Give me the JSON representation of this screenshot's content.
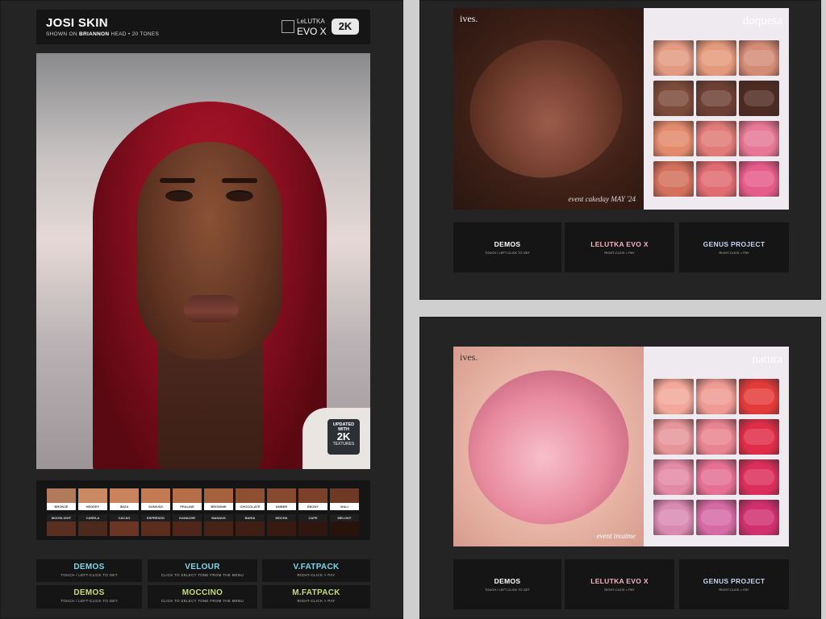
{
  "josi": {
    "title": "JOSI SKIN",
    "subtitle_pre": "SHOWN ON",
    "subtitle_head": "BRIANNON",
    "subtitle_post": "HEAD  •  20 TONES",
    "brand_line1": "LeLUTKA",
    "brand_line2": "EVO X",
    "badge_2k": "2K",
    "updated_badge": {
      "line1": "UPDATED WITH",
      "line2": "2K",
      "line3": "TEXTURES"
    }
  },
  "swatches_row1": [
    {
      "name": "BRONZE",
      "color": "#b17a5a"
    },
    {
      "name": "HEDDEY",
      "color": "#c98a63"
    },
    {
      "name": "IBIZA",
      "color": "#c9845d"
    },
    {
      "name": "SUNKISS",
      "color": "#c47a53"
    },
    {
      "name": "PRALINE",
      "color": "#b66e49"
    },
    {
      "name": "BROWNIE",
      "color": "#a5603e"
    },
    {
      "name": "CHOCOLATE",
      "color": "#8f4f33"
    },
    {
      "name": "AMBER",
      "color": "#87492f"
    },
    {
      "name": "EBONY",
      "color": "#7c4229"
    },
    {
      "name": "MALI",
      "color": "#6e3a25"
    }
  ],
  "swatches_row2": [
    {
      "name": "MOONLIGHT",
      "color": "#5a2f20"
    },
    {
      "name": "CARELA",
      "color": "#4d281c"
    },
    {
      "name": "CACAO",
      "color": "#6b3524"
    },
    {
      "name": "ESPRESSO",
      "color": "#5c2d1f"
    },
    {
      "name": "GANACHE",
      "color": "#4f2619"
    },
    {
      "name": "MANAUS",
      "color": "#472216"
    },
    {
      "name": "BAHIA",
      "color": "#3f1e14"
    },
    {
      "name": "MOCHA",
      "color": "#371a11"
    },
    {
      "name": "CAFE",
      "color": "#2f160e"
    },
    {
      "name": "MELONY",
      "color": "#28130c"
    }
  ],
  "left_buttons": [
    {
      "label": "DEMOS",
      "sub": "TOUCH / LEFT-CLICK TO GET",
      "color": "#7fd6e6"
    },
    {
      "label": "VELOUR",
      "sub": "CLICK TO SELECT TONE FROM THE MENU",
      "color": "#7fd6e6"
    },
    {
      "label": "V.FATPACK",
      "sub": "RIGHT-CLICK > PAY",
      "color": "#7fd6e6"
    },
    {
      "label": "DEMOS",
      "sub": "TOUCH / LEFT-CLICK TO GET",
      "color": "#c6dc7a"
    },
    {
      "label": "MOCCINO",
      "sub": "CLICK TO SELECT TONE FROM THE MENU",
      "color": "#c6dc7a"
    },
    {
      "label": "M.FATPACK",
      "sub": "RIGHT-CLICK > PAY",
      "color": "#c6dc7a"
    }
  ],
  "duquesa": {
    "brand": "ives.",
    "collection": "duquesa",
    "event": "event cakeday MAY '24",
    "cells": [
      "#e29a82",
      "#e49a7c",
      "#d58c77",
      "#7c4a3a",
      "#6d3f33",
      "#4d2a22",
      "#e28a6c",
      "#e07b78",
      "#e67896",
      "#d2705b",
      "#e06c72",
      "#e55c8a"
    ],
    "buttons": [
      {
        "label": "DEMOS",
        "sub": "TOUCH / LEFT-CLICK TO GET",
        "color": "#ffffff"
      },
      {
        "label": "LELUTKA EVO X",
        "sub": "RIGHT-CLICK > PAY",
        "color": "#f2b6c4"
      },
      {
        "label": "GENUS PROJECT",
        "sub": "RIGHT-CLICK > PAY",
        "color": "#c6d4f2"
      }
    ]
  },
  "natura": {
    "brand": "ives.",
    "collection": "natura",
    "event": "event treatme",
    "cells": [
      "#f2a89a",
      "#ef9b94",
      "#e33b3a",
      "#e6969a",
      "#e88491",
      "#e02c48",
      "#e28aa6",
      "#e57095",
      "#dc2e5a",
      "#d98ab2",
      "#d56aa4",
      "#d0306e"
    ],
    "buttons": [
      {
        "label": "DEMOS",
        "sub": "TOUCH / LEFT-CLICK TO GET",
        "color": "#ffffff"
      },
      {
        "label": "LELUTKA EVO X",
        "sub": "RIGHT-CLICK > PAY",
        "color": "#f2b6c4"
      },
      {
        "label": "GENUS PROJECT",
        "sub": "RIGHT-CLICK > PAY",
        "color": "#c6d4f2"
      }
    ]
  }
}
